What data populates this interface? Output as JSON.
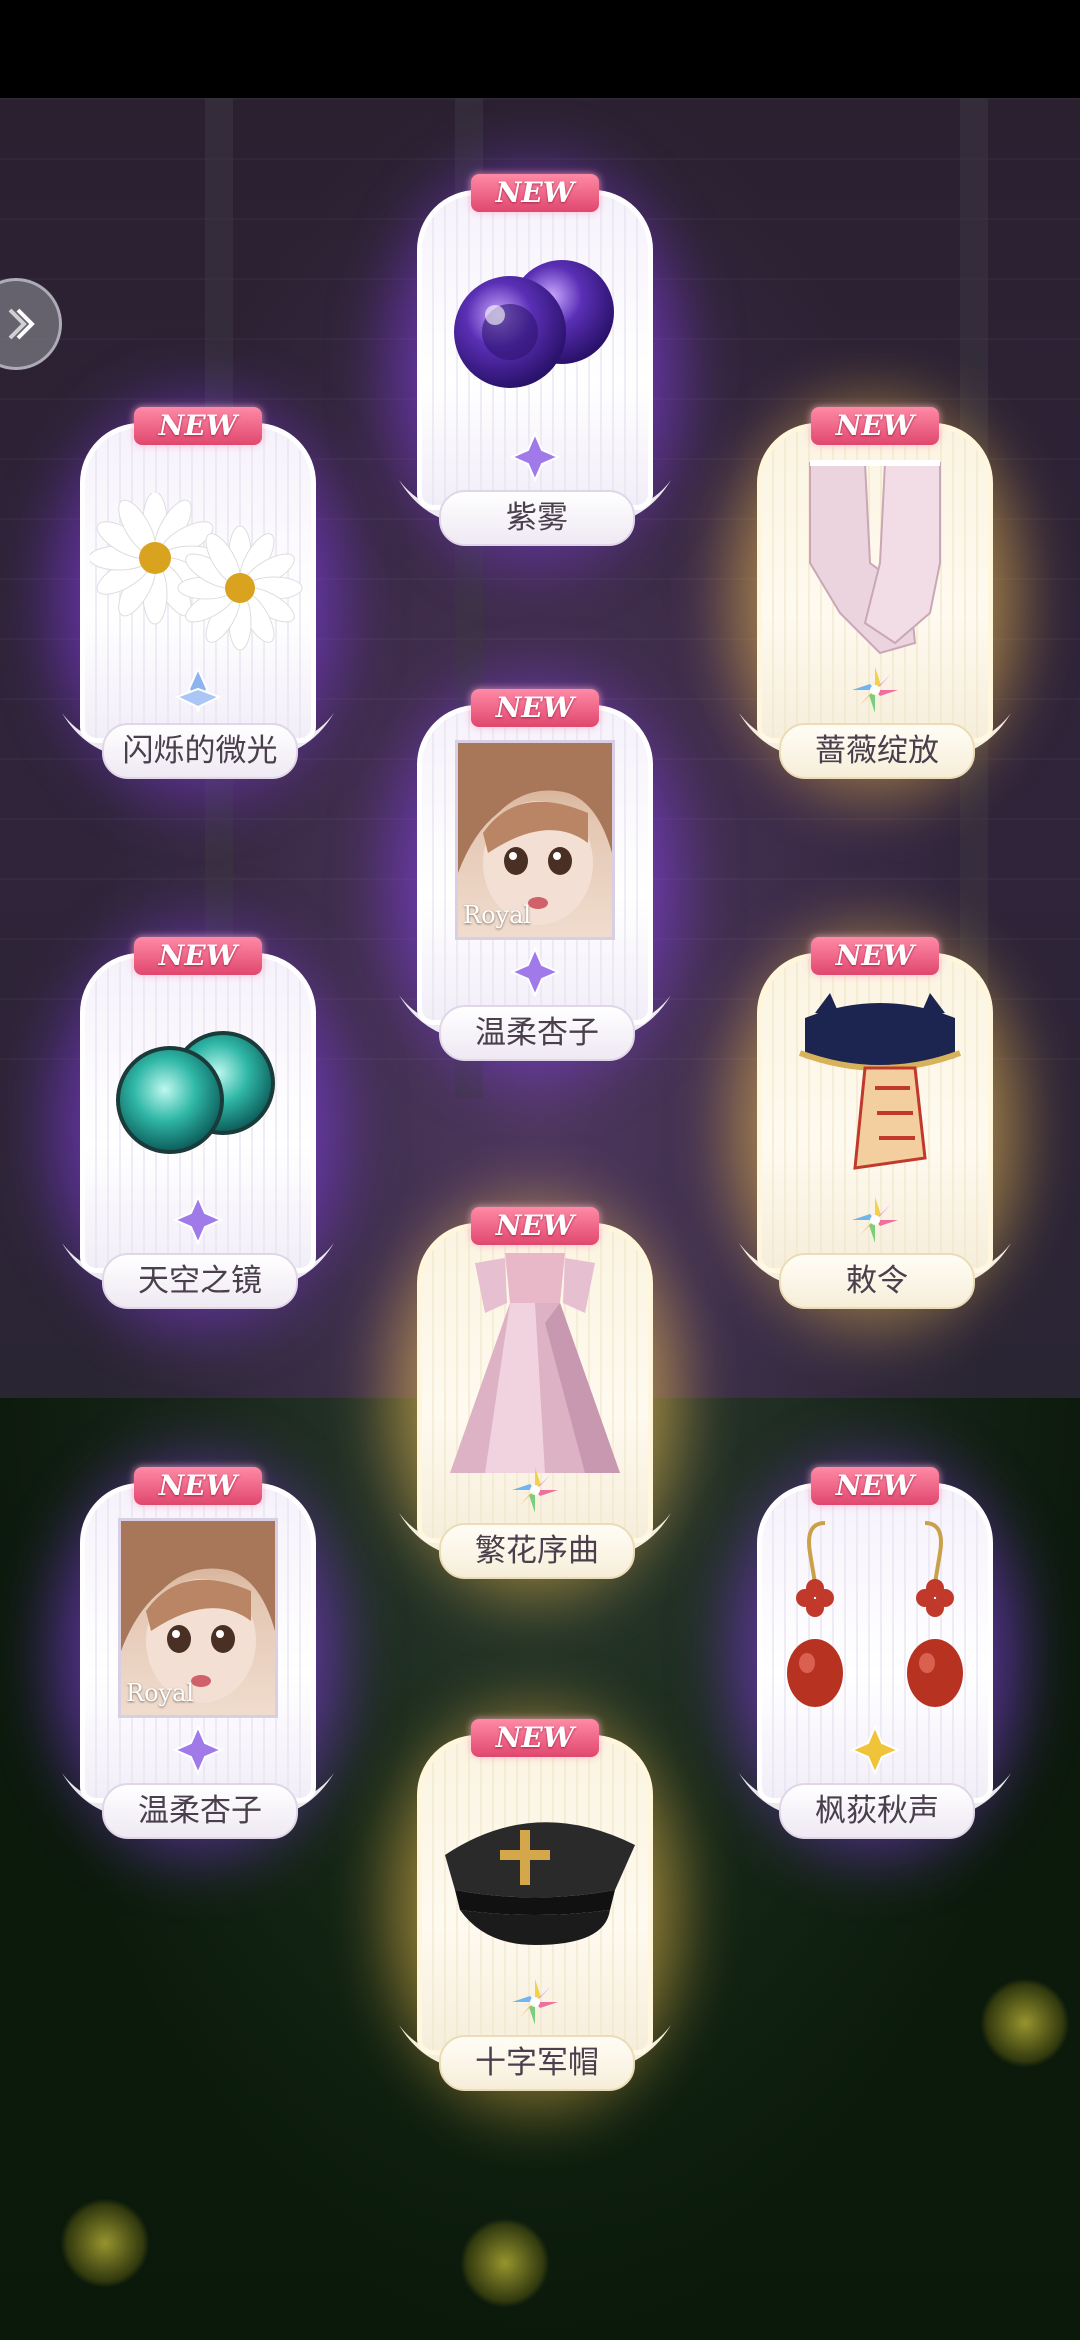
{
  "badge_text": "NEW",
  "royal_text": "Royal",
  "cards": [
    {
      "id": "c1",
      "name": "紫雾",
      "rarity": "purple",
      "item_icon": "purple-orb-icon",
      "gem": "purple-gem-icon"
    },
    {
      "id": "c2",
      "name": "闪烁的微光",
      "rarity": "purple",
      "item_icon": "daisy-hairpin-icon",
      "gem": "blue-gem-icon"
    },
    {
      "id": "c3",
      "name": "蔷薇绽放",
      "rarity": "gold",
      "item_icon": "lace-gloves-icon",
      "gem": "rainbow-gem-icon"
    },
    {
      "id": "c4",
      "name": "温柔杏子",
      "rarity": "purple",
      "item_icon": "doll-face-portrait",
      "gem": "purple-gem-icon"
    },
    {
      "id": "c5",
      "name": "天空之镜",
      "rarity": "purple",
      "item_icon": "teal-orb-icon",
      "gem": "purple-gem-icon"
    },
    {
      "id": "c6",
      "name": "敕令",
      "rarity": "gold",
      "item_icon": "talisman-hat-icon",
      "gem": "rainbow-gem-icon"
    },
    {
      "id": "c7",
      "name": "繁花序曲",
      "rarity": "gold",
      "item_icon": "pink-gown-icon",
      "gem": "rainbow-gem-icon"
    },
    {
      "id": "c8",
      "name": "温柔杏子",
      "rarity": "purple",
      "item_icon": "doll-face-portrait",
      "gem": "purple-gem-icon"
    },
    {
      "id": "c9",
      "name": "枫荻秋声",
      "rarity": "purple",
      "item_icon": "red-earrings-icon",
      "gem": "yellow-gem-icon"
    },
    {
      "id": "c10",
      "name": "十字军帽",
      "rarity": "gold",
      "item_icon": "military-cap-icon",
      "gem": "rainbow-gem-icon"
    }
  ]
}
